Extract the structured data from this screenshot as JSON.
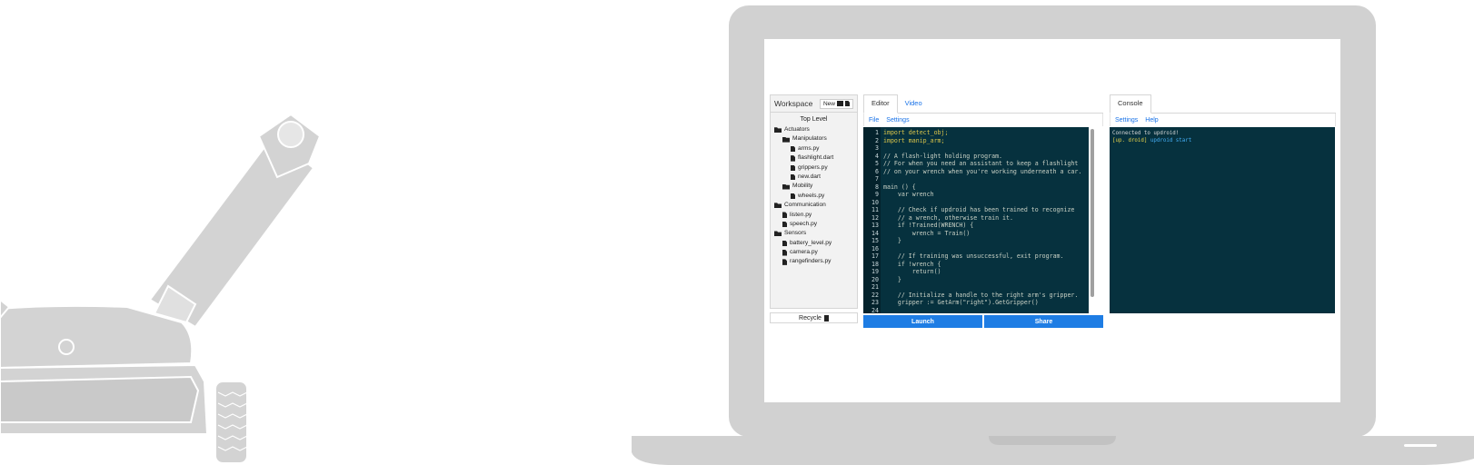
{
  "workspace": {
    "title": "Workspace",
    "new_label": "New",
    "top_level": "Top Level",
    "recycle_label": "Recycle",
    "tree": [
      {
        "label": "Actuators",
        "type": "folder",
        "depth": 0
      },
      {
        "label": "Manipulators",
        "type": "folder",
        "depth": 1
      },
      {
        "label": "arms.py",
        "type": "file",
        "depth": 2
      },
      {
        "label": "flashlight.dart",
        "type": "file",
        "depth": 2
      },
      {
        "label": "grippers.py",
        "type": "file",
        "depth": 2
      },
      {
        "label": "new.dart",
        "type": "file",
        "depth": 2
      },
      {
        "label": "Mobility",
        "type": "folder",
        "depth": 1
      },
      {
        "label": "wheels.py",
        "type": "file",
        "depth": 2
      },
      {
        "label": "Communication",
        "type": "folder",
        "depth": 0
      },
      {
        "label": "listen.py",
        "type": "file",
        "depth": 1
      },
      {
        "label": "speech.py",
        "type": "file",
        "depth": 1
      },
      {
        "label": "Sensors",
        "type": "folder",
        "depth": 0
      },
      {
        "label": "battery_level.py",
        "type": "file",
        "depth": 1
      },
      {
        "label": "camera.py",
        "type": "file",
        "depth": 1
      },
      {
        "label": "rangefinders.py",
        "type": "file",
        "depth": 1
      }
    ]
  },
  "editor": {
    "tabs": [
      "Editor",
      "Video"
    ],
    "menu": [
      "File",
      "Settings"
    ],
    "code_lines": [
      "import detect_obj;",
      "import manip_arm;",
      "",
      "// A flash-light holding program.",
      "// For when you need an assistant to keep a flashlight",
      "// on your wrench when you're working underneath a car.",
      "",
      "main () {",
      "    var wrench",
      "",
      "    // Check if updroid has been trained to recognize",
      "    // a wrench, otherwise train it.",
      "    if !Trained(WRENCH) {",
      "        wrench = Train()",
      "    }",
      "",
      "    // If training was unsuccessful, exit program.",
      "    if !wrench {",
      "        return()",
      "    }",
      "",
      "    // Initialize a handle to the right arm's gripper.",
      "    gripper := GetArm(\"right\").GetGripper()",
      ""
    ],
    "launch_label": "Launch",
    "share_label": "Share"
  },
  "console": {
    "tab": "Console",
    "menu": [
      "Settings",
      "Help"
    ],
    "prompt": "[up. droid]",
    "lines": [
      "Connected to updroid!",
      "updroid start"
    ]
  },
  "colors": {
    "code_bg": "#06313e",
    "accent": "#1e7de4",
    "laptop": "#d1d1d1"
  }
}
